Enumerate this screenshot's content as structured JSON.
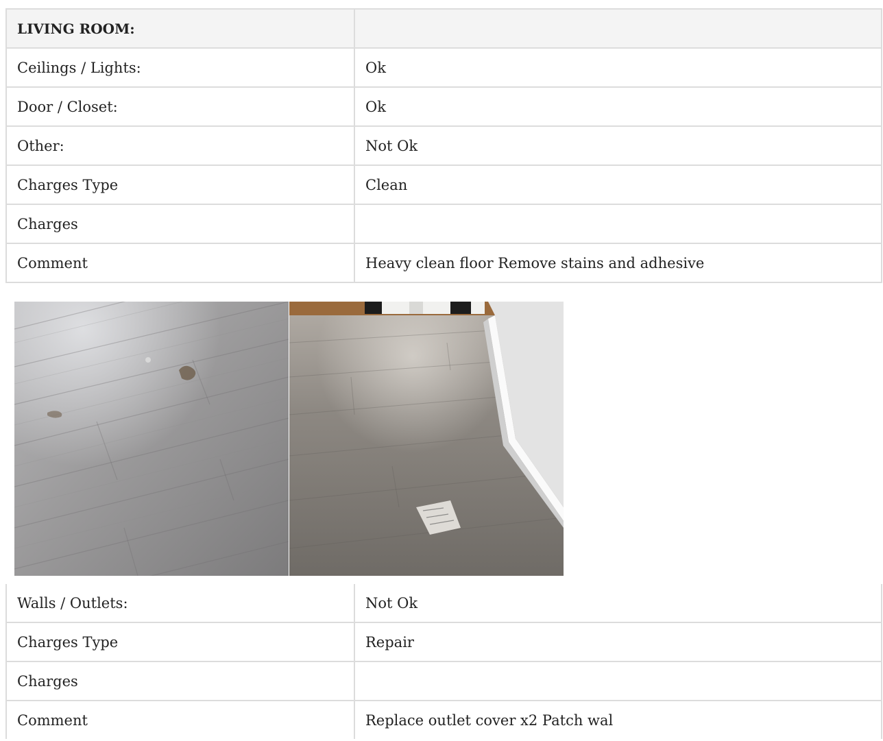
{
  "section": {
    "title": "LIVING ROOM:",
    "title_value": ""
  },
  "rows_top": [
    {
      "label": "Ceilings / Lights:",
      "value": "Ok"
    },
    {
      "label": "Door / Closet:",
      "value": "Ok"
    },
    {
      "label": "Other:",
      "value": "Not Ok"
    },
    {
      "label": "Charges Type",
      "value": "Clean"
    },
    {
      "label": "Charges",
      "value": ""
    },
    {
      "label": "Comment",
      "value": "Heavy clean floor Remove stains and adhesive"
    }
  ],
  "photos": [
    {
      "subject": "grey laminate floor with stains"
    },
    {
      "subject": "grey laminate floor near wall with adhesive residue"
    }
  ],
  "rows_bottom": [
    {
      "label": "Walls / Outlets:",
      "value": "Not Ok"
    },
    {
      "label": "Charges Type",
      "value": "Repair"
    },
    {
      "label": "Charges",
      "value": ""
    },
    {
      "label": "Comment",
      "value": "Replace outlet cover x2 Patch wal"
    }
  ]
}
